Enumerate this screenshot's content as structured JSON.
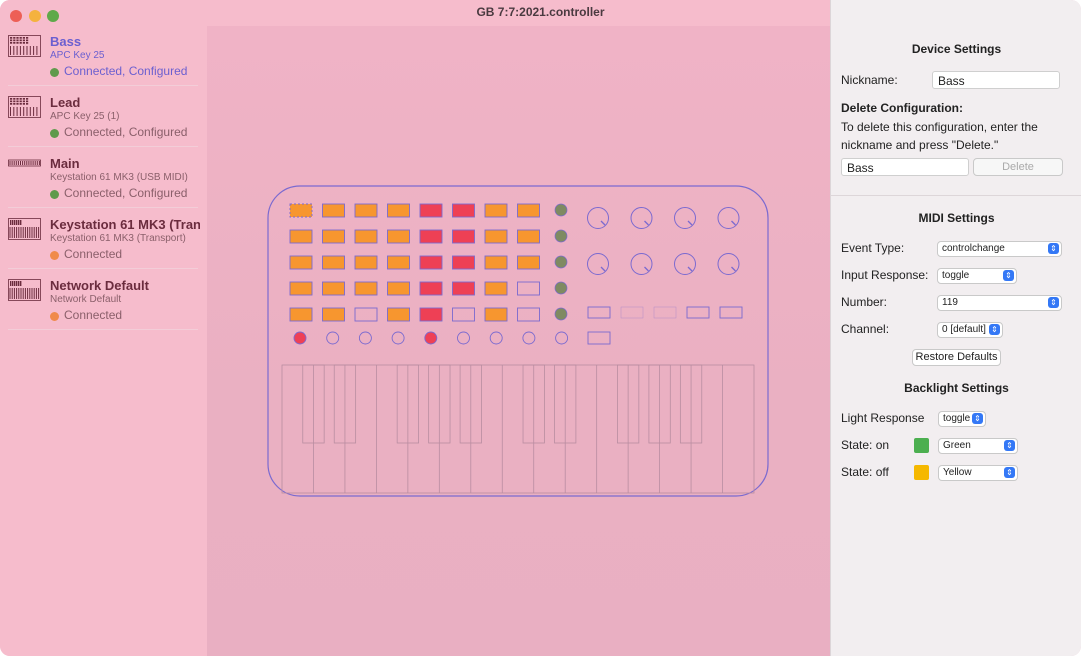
{
  "window": {
    "title": "GB 7:7:2021.controller"
  },
  "devices": [
    {
      "name": "Bass",
      "model": "APC Key 25",
      "status": "Connected, Configured",
      "status_color": "#5f9a4c",
      "selected": true
    },
    {
      "name": "Lead",
      "model": "APC Key 25 (1)",
      "status": "Connected, Configured",
      "status_color": "#5f9a4c"
    },
    {
      "name": "Main",
      "model": "Keystation 61 MK3 (USB MIDI)",
      "status": "Connected, Configured",
      "status_color": "#5f9a4c"
    },
    {
      "name": "Keystation 61 MK3 (Tran",
      "model": "Keystation 61 MK3 (Transport)",
      "status": "Connected",
      "status_color": "#f08a4b"
    },
    {
      "name": "Network Default",
      "model": "Network Default",
      "status": "Connected",
      "status_color": "#f08a4b"
    }
  ],
  "device_settings": {
    "title": "Device Settings",
    "nickname_label": "Nickname:",
    "nickname_value": "Bass",
    "delete_title": "Delete Configuration:",
    "delete_text": "To delete this configuration, enter the nickname and press \"Delete.\"",
    "delete_input_value": "Bass",
    "delete_button": "Delete"
  },
  "midi_settings": {
    "title": "MIDI Settings",
    "event_type_label": "Event Type:",
    "event_type_value": "controlchange",
    "input_response_label": "Input Response:",
    "input_response_value": "toggle",
    "number_label": "Number:",
    "number_value": "119",
    "channel_label": "Channel:",
    "channel_value": "0 [default]",
    "restore_button": "Restore Defaults"
  },
  "backlight_settings": {
    "title": "Backlight Settings",
    "light_response_label": "Light Response",
    "light_response_value": "toggle",
    "state_on_label": "State: on",
    "state_on_value": "Green",
    "state_on_color": "#4caf50",
    "state_off_label": "State: off",
    "state_off_value": "Yellow",
    "state_off_color": "#f5b800"
  },
  "controller": {
    "pad_grid": [
      [
        "orange",
        "orange",
        "orange",
        "orange",
        "red",
        "red",
        "orange",
        "orange"
      ],
      [
        "orange",
        "orange",
        "orange",
        "orange",
        "red",
        "red",
        "orange",
        "orange"
      ],
      [
        "orange",
        "orange",
        "orange",
        "orange",
        "red",
        "red",
        "orange",
        "orange"
      ],
      [
        "orange",
        "orange",
        "orange",
        "orange",
        "red",
        "red",
        "orange",
        "empty"
      ],
      [
        "orange",
        "orange",
        "empty",
        "orange",
        "red",
        "empty",
        "orange",
        "empty"
      ]
    ],
    "colors": {
      "orange": "#f7962f",
      "red": "#ee4055",
      "green_knob": "#7f8a62",
      "outline": "#7b6ad0"
    }
  }
}
